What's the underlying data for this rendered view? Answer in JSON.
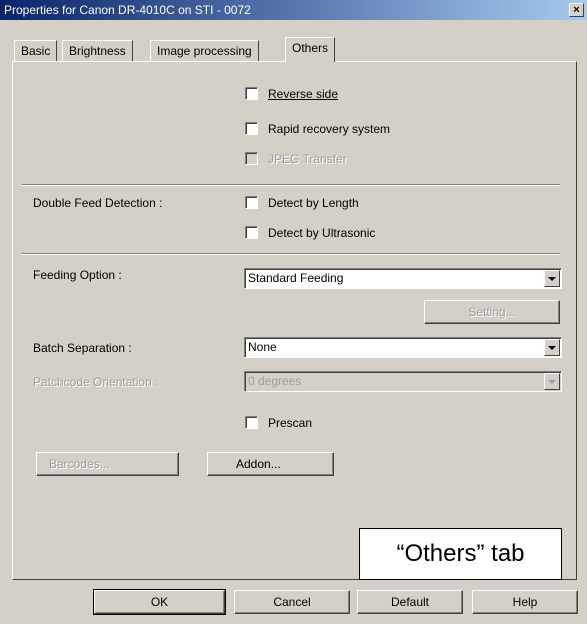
{
  "window": {
    "title": "Properties for Canon DR-4010C on STI - 0072",
    "close_glyph": "×"
  },
  "tabs": [
    {
      "label": "Basic"
    },
    {
      "label": "Brightness"
    },
    {
      "label": "Image processing"
    },
    {
      "label": "Others",
      "active": true
    }
  ],
  "others": {
    "reverse_side": {
      "label": "Reverse side",
      "checked": false
    },
    "rapid_recovery": {
      "label": "Rapid recovery system",
      "checked": false
    },
    "jpeg_transfer": {
      "label": "JPEG Transfer",
      "checked": false,
      "enabled": false
    },
    "double_feed": {
      "label": "Double Feed Detection :",
      "by_length": {
        "label": "Detect by Length",
        "checked": false
      },
      "by_ultrasonic": {
        "label": "Detect by Ultrasonic",
        "checked": false
      }
    },
    "feeding_option": {
      "label": "Feeding Option :",
      "value": "Standard Feeding",
      "setting_label": "Setting..."
    },
    "batch_separation": {
      "label": "Batch Separation :",
      "value": "None"
    },
    "patchcode_orientation": {
      "label": "Patchcode Orientation :",
      "value": "0 degrees",
      "enabled": false
    },
    "prescan": {
      "label": "Prescan",
      "checked": false
    },
    "barcodes_label": "Barcodes...",
    "addon_label": "Addon..."
  },
  "annotation": "“Others” tab",
  "buttons": {
    "ok": "OK",
    "cancel": "Cancel",
    "default": "Default",
    "help": "Help"
  },
  "colors": {
    "face": "#d4d0c8",
    "title_bar": "#0a246a",
    "disabled_text": "#9e9e9e"
  }
}
